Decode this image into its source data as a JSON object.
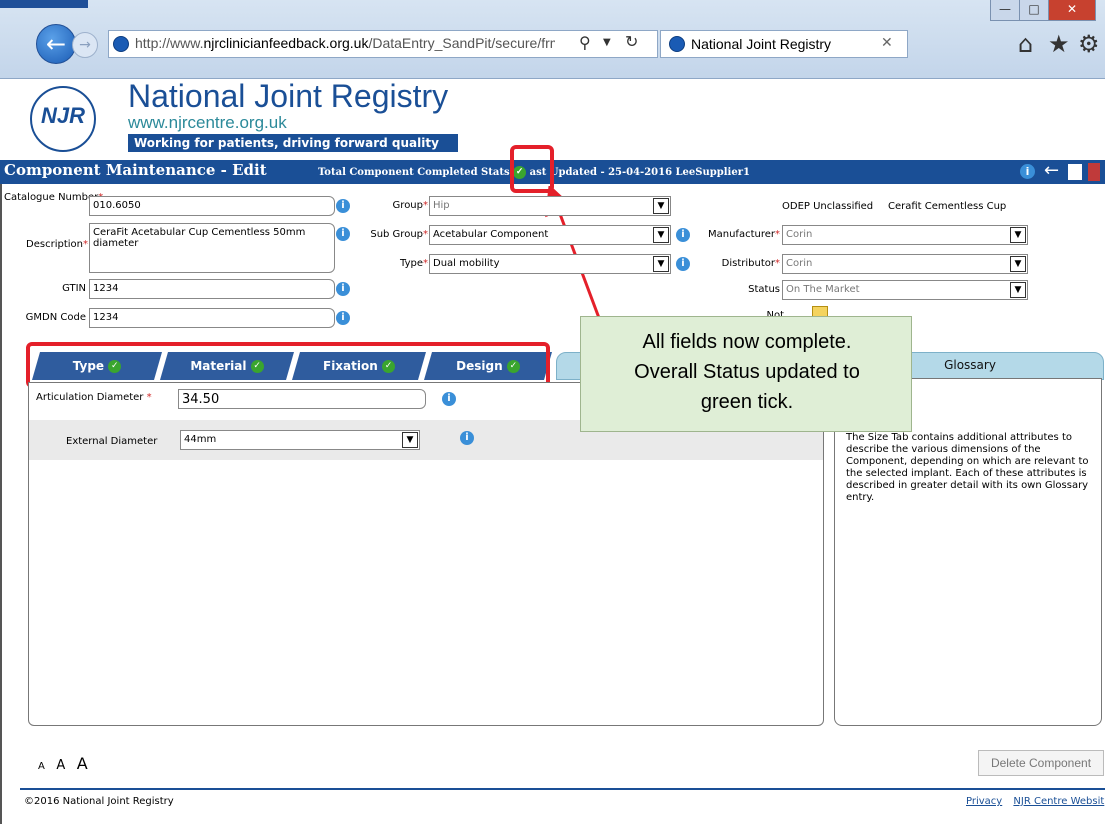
{
  "browser": {
    "url_prefix": "http://www.",
    "url_domain": "njrclinicianfeedback.org.uk",
    "url_path": "/DataEntry_SandPit/secure/frm",
    "tab_title": "National Joint Registry",
    "back_icon": "back-arrow-icon",
    "forward_icon": "forward-arrow-icon"
  },
  "brand": {
    "logo_text": "NJR",
    "name": "National Joint Registry",
    "url": "www.njrcentre.org.uk",
    "tagline": "Working for patients, driving forward quality"
  },
  "titlebar": {
    "title": "Component Maintenance - Edit",
    "status_label": "Total Component Completed Stat",
    "status_label_tail": "s",
    "last_updated": "ast Updated - 25-04-2016 LeeSupplier1"
  },
  "form": {
    "catalogue_label": "Catalogue Number",
    "catalogue_value": "010.6050",
    "description_label": "Description",
    "description_value": "CeraFit Acetabular Cup Cementless 50mm diameter",
    "gtin_label": "GTIN",
    "gtin_value": "1234",
    "gmdn_label": "GMDN Code",
    "gmdn_value": "1234",
    "group_label": "Group",
    "group_value": "Hip",
    "subgroup_label": "Sub Group",
    "subgroup_value": "Acetabular Component",
    "type_label": "Type",
    "type_value": "Dual mobility",
    "odep": "ODEP Unclassified",
    "product_name": "Cerafit Cementless Cup",
    "manufacturer_label": "Manufacturer",
    "manufacturer_value": "Corin",
    "distributor_label": "Distributor",
    "distributor_value": "Corin",
    "status_label": "Status",
    "status_value": "On The Market",
    "notes_label": "Not"
  },
  "tabs": {
    "type": "Type",
    "material": "Material",
    "fixation": "Fixation",
    "design": "Design",
    "glossary": "Glossary"
  },
  "size_tab": {
    "articulation_label": "Articulation Diameter",
    "articulation_value": "34.50",
    "external_label": "External Diameter",
    "external_value": "44mm"
  },
  "glossary_text": "The Size Tab contains additional attributes to describe the various dimensions of the Component, depending on which are relevant to the selected implant. Each of these attributes is described in greater detail with its own Glossary entry.",
  "callout": {
    "line1": "All fields now complete.",
    "line2": "Overall Status updated to",
    "line3": "green tick."
  },
  "footer": {
    "font_small": "A",
    "font_medium": "A",
    "font_large": "A",
    "delete_button": "Delete Component",
    "copyright": "©2016 National Joint Registry",
    "privacy": "Privacy",
    "centre_link": "NJR Centre Websit"
  },
  "colors": {
    "brand_blue": "#1a4f96",
    "highlight_red": "#e4202a",
    "tick_green": "#3aa52e"
  }
}
